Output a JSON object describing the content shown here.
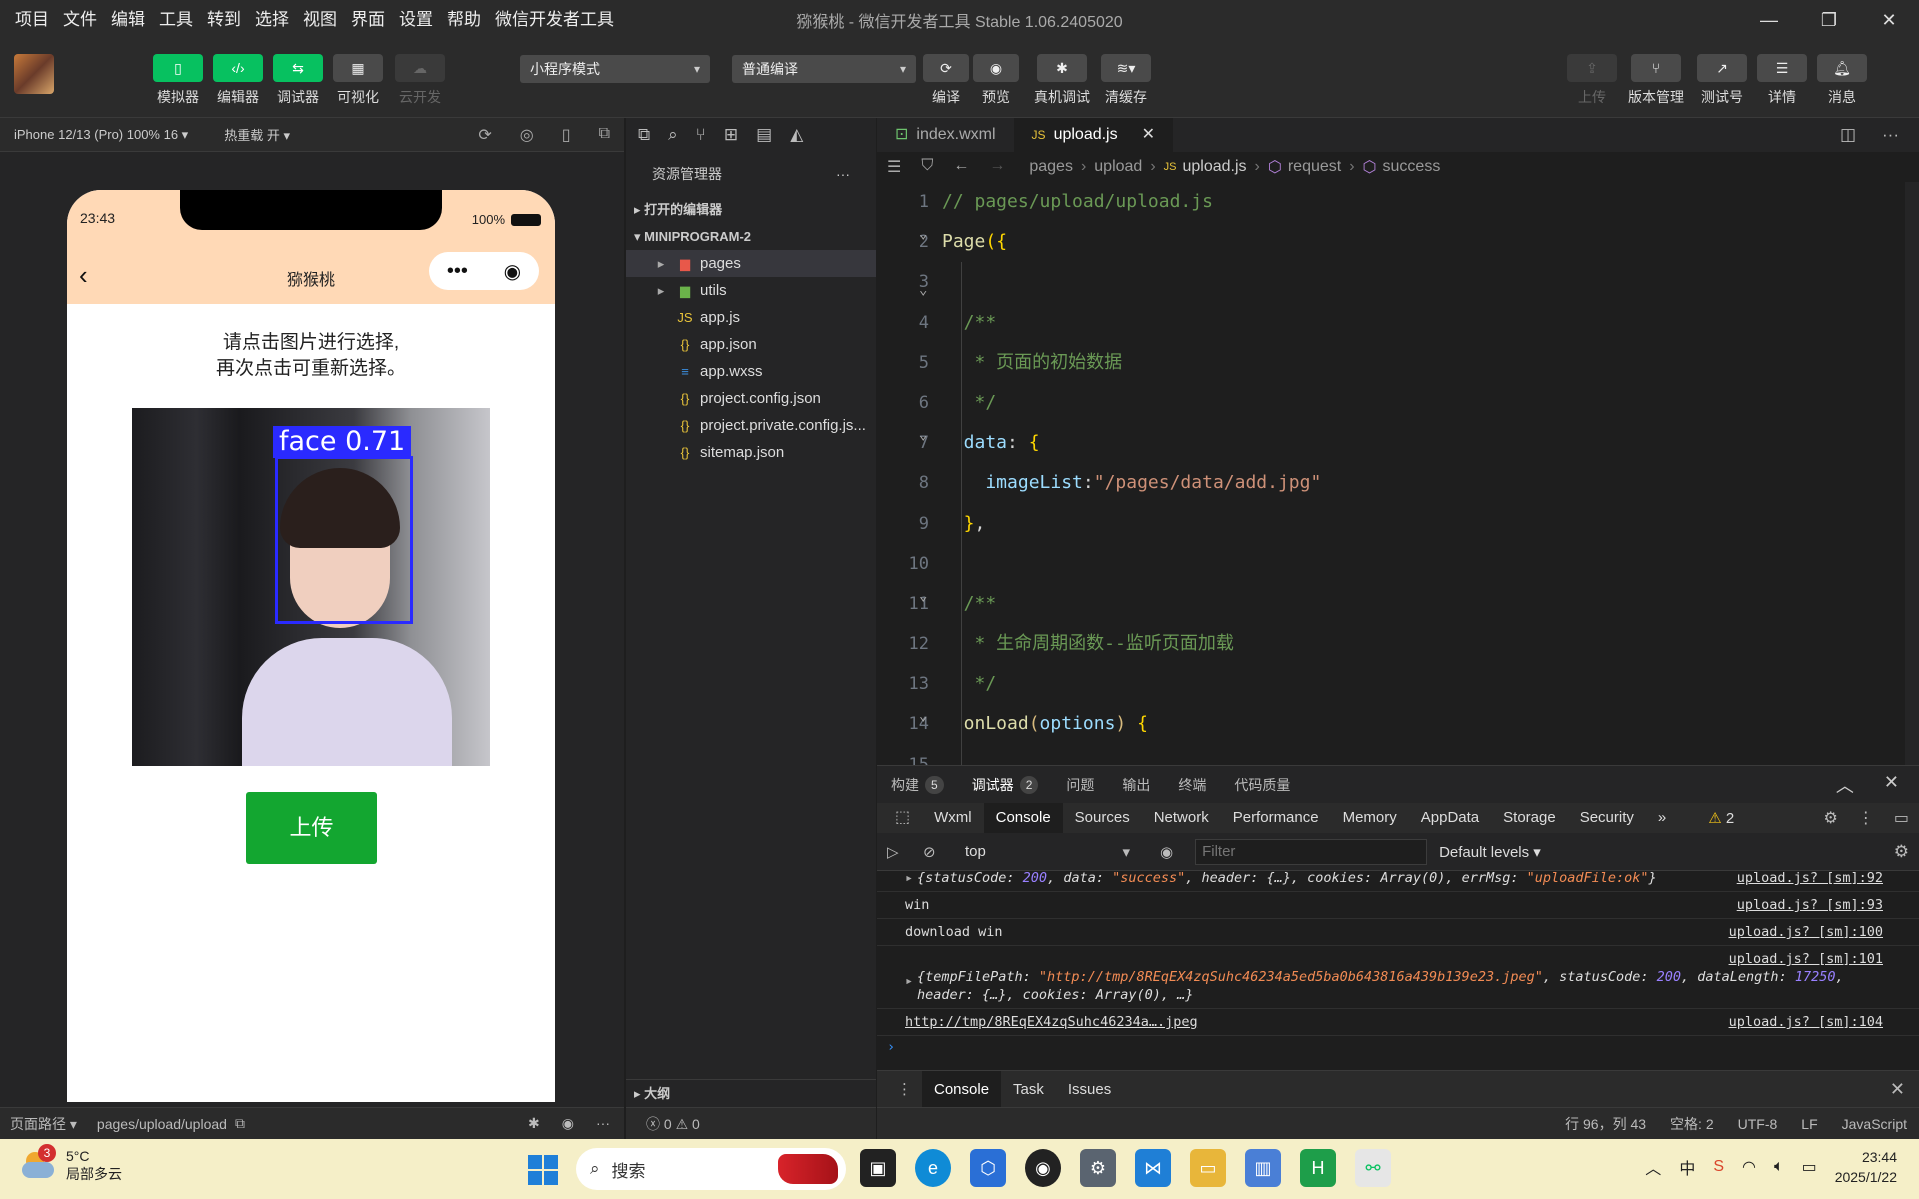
{
  "menu": [
    "项目",
    "文件",
    "编辑",
    "工具",
    "转到",
    "选择",
    "视图",
    "界面",
    "设置",
    "帮助",
    "微信开发者工具"
  ],
  "window_title": "猕猴桃 - 微信开发者工具 Stable 1.06.2405020",
  "toolbar": {
    "simulator": "模拟器",
    "editor": "编辑器",
    "debugger": "调试器",
    "visual": "可视化",
    "cloud": "云开发",
    "mode": "小程序模式",
    "compile_mode": "普通编译",
    "compile": "编译",
    "preview": "预览",
    "real_debug": "真机调试",
    "clear_cache": "清缓存",
    "upload": "上传",
    "version": "版本管理",
    "test": "测试号",
    "details": "详情",
    "messages": "消息"
  },
  "simulator": {
    "device": "iPhone 12/13 (Pro) 100% 16",
    "hot_reload": "热重载 开",
    "time": "23:43",
    "battery": "100%",
    "nav_title": "猕猴桃",
    "hint_line1": "请点击图片进行选择,",
    "hint_line2": "再次点击可重新选择。",
    "detection_label": "face  0.71",
    "upload_button": "上传",
    "route_label": "页面路径",
    "route_path": "pages/upload/upload"
  },
  "explorer": {
    "title": "资源管理器",
    "open_editors": "打开的编辑器",
    "project": "MINIPROGRAM-2",
    "items": [
      {
        "name": "pages",
        "type": "folder-red",
        "level": 1
      },
      {
        "name": "utils",
        "type": "folder-green",
        "level": 1
      },
      {
        "name": "app.js",
        "type": "js",
        "level": 0
      },
      {
        "name": "app.json",
        "type": "json",
        "level": 0
      },
      {
        "name": "app.wxss",
        "type": "wxss",
        "level": 0
      },
      {
        "name": "project.config.json",
        "type": "json",
        "level": 0
      },
      {
        "name": "project.private.config.js...",
        "type": "json",
        "level": 0
      },
      {
        "name": "sitemap.json",
        "type": "json",
        "level": 0
      }
    ],
    "outline": "大纲",
    "errors": "0",
    "warnings": "0"
  },
  "editor": {
    "tabs": [
      {
        "name": "index.wxml",
        "active": false
      },
      {
        "name": "upload.js",
        "active": true
      }
    ],
    "breadcrumb": [
      "pages",
      "upload",
      "upload.js",
      "request",
      "success"
    ],
    "lines": [
      "1",
      "2",
      "3",
      "4",
      "5",
      "6",
      "7",
      "8",
      "9",
      "10",
      "11",
      "12",
      "13",
      "14",
      "15"
    ]
  },
  "panel": {
    "tabs": [
      {
        "name": "构建",
        "badge": "5"
      },
      {
        "name": "调试器",
        "badge": "2"
      },
      {
        "name": "问题",
        "badge": ""
      },
      {
        "name": "输出",
        "badge": ""
      },
      {
        "name": "终端",
        "badge": ""
      },
      {
        "name": "代码质量",
        "badge": ""
      }
    ],
    "devtools_tabs": [
      "Wxml",
      "Console",
      "Sources",
      "Network",
      "Performance",
      "Memory",
      "AppData",
      "Storage",
      "Security"
    ],
    "warnings_count": "2",
    "context": "top",
    "filter_placeholder": "Filter",
    "levels": "Default levels",
    "console": [
      {
        "src": "upload.js? [sm]:92"
      },
      {
        "text": "win",
        "src": "upload.js? [sm]:93"
      },
      {
        "text": "download win",
        "src": "upload.js? [sm]:100"
      },
      {
        "src": "upload.js? [sm]:101"
      },
      {
        "text": "http://tmp/8REqEX4zqSuhc46234a….jpeg",
        "src": "upload.js? [sm]:104"
      }
    ],
    "drawer_tabs": [
      "Console",
      "Task",
      "Issues"
    ]
  },
  "status": {
    "position": "行 96，列 43",
    "spaces": "空格: 2",
    "encoding": "UTF-8",
    "eol": "LF",
    "language": "JavaScript"
  },
  "taskbar": {
    "weather_badge": "3",
    "temperature": "5°C",
    "weather": "局部多云",
    "search": "搜索",
    "ime": "中",
    "time": "23:44",
    "date": "2025/1/22"
  }
}
